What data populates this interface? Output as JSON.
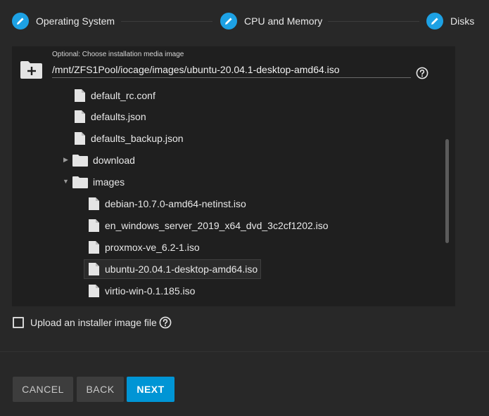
{
  "stepper": {
    "steps": [
      {
        "label": "Operating System",
        "icon": "pencil-icon"
      },
      {
        "label": "CPU and Memory",
        "icon": "pencil-icon"
      },
      {
        "label": "Disks",
        "icon": "pencil-icon"
      }
    ]
  },
  "media": {
    "caption": "Optional: Choose installation media image",
    "path_value": "/mnt/ZFS1Pool/iocage/images/ubuntu-20.04.1-desktop-amd64.iso"
  },
  "tree": {
    "items": [
      {
        "label": "default_rc.conf",
        "type": "file"
      },
      {
        "label": "defaults.json",
        "type": "file"
      },
      {
        "label": "defaults_backup.json",
        "type": "file"
      },
      {
        "label": "download",
        "type": "folder",
        "expanded": false
      },
      {
        "label": "images",
        "type": "folder",
        "expanded": true
      },
      {
        "label": "debian-10.7.0-amd64-netinst.iso",
        "type": "file"
      },
      {
        "label": "en_windows_server_2019_x64_dvd_3c2cf1202.iso",
        "type": "file"
      },
      {
        "label": "proxmox-ve_6.2-1.iso",
        "type": "file"
      },
      {
        "label": "ubuntu-20.04.1-desktop-amd64.iso",
        "type": "file",
        "selected": true
      },
      {
        "label": "virtio-win-0.1.185.iso",
        "type": "file"
      }
    ]
  },
  "upload": {
    "label": "Upload an installer image file",
    "checked": false
  },
  "buttons": {
    "cancel": "CANCEL",
    "back": "BACK",
    "next": "NEXT"
  },
  "colors": {
    "accent": "#0095d5",
    "step_circle": "#1da1e4",
    "background": "#282828",
    "panel": "#1f1f1f"
  }
}
